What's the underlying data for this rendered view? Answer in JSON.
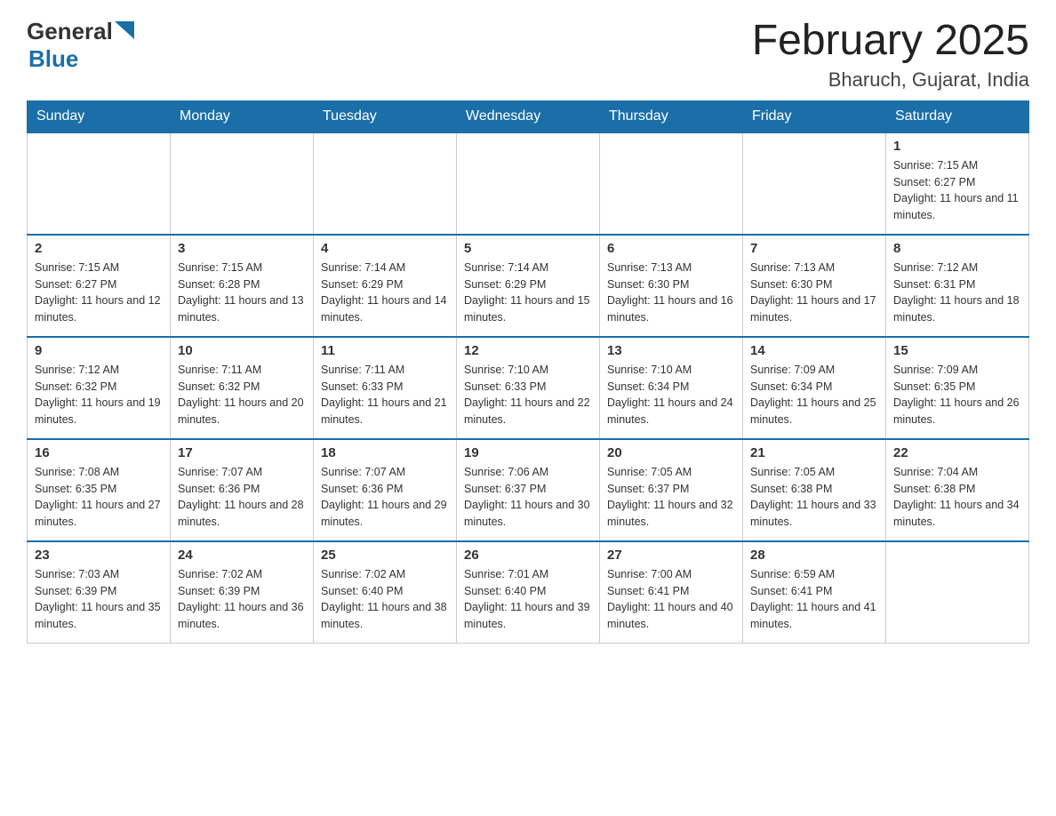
{
  "header": {
    "logo_general": "General",
    "logo_blue": "Blue",
    "month_year": "February 2025",
    "location": "Bharuch, Gujarat, India"
  },
  "days_of_week": [
    "Sunday",
    "Monday",
    "Tuesday",
    "Wednesday",
    "Thursday",
    "Friday",
    "Saturday"
  ],
  "weeks": [
    [
      {
        "day": "",
        "info": ""
      },
      {
        "day": "",
        "info": ""
      },
      {
        "day": "",
        "info": ""
      },
      {
        "day": "",
        "info": ""
      },
      {
        "day": "",
        "info": ""
      },
      {
        "day": "",
        "info": ""
      },
      {
        "day": "1",
        "info": "Sunrise: 7:15 AM\nSunset: 6:27 PM\nDaylight: 11 hours and 11 minutes."
      }
    ],
    [
      {
        "day": "2",
        "info": "Sunrise: 7:15 AM\nSunset: 6:27 PM\nDaylight: 11 hours and 12 minutes."
      },
      {
        "day": "3",
        "info": "Sunrise: 7:15 AM\nSunset: 6:28 PM\nDaylight: 11 hours and 13 minutes."
      },
      {
        "day": "4",
        "info": "Sunrise: 7:14 AM\nSunset: 6:29 PM\nDaylight: 11 hours and 14 minutes."
      },
      {
        "day": "5",
        "info": "Sunrise: 7:14 AM\nSunset: 6:29 PM\nDaylight: 11 hours and 15 minutes."
      },
      {
        "day": "6",
        "info": "Sunrise: 7:13 AM\nSunset: 6:30 PM\nDaylight: 11 hours and 16 minutes."
      },
      {
        "day": "7",
        "info": "Sunrise: 7:13 AM\nSunset: 6:30 PM\nDaylight: 11 hours and 17 minutes."
      },
      {
        "day": "8",
        "info": "Sunrise: 7:12 AM\nSunset: 6:31 PM\nDaylight: 11 hours and 18 minutes."
      }
    ],
    [
      {
        "day": "9",
        "info": "Sunrise: 7:12 AM\nSunset: 6:32 PM\nDaylight: 11 hours and 19 minutes."
      },
      {
        "day": "10",
        "info": "Sunrise: 7:11 AM\nSunset: 6:32 PM\nDaylight: 11 hours and 20 minutes."
      },
      {
        "day": "11",
        "info": "Sunrise: 7:11 AM\nSunset: 6:33 PM\nDaylight: 11 hours and 21 minutes."
      },
      {
        "day": "12",
        "info": "Sunrise: 7:10 AM\nSunset: 6:33 PM\nDaylight: 11 hours and 22 minutes."
      },
      {
        "day": "13",
        "info": "Sunrise: 7:10 AM\nSunset: 6:34 PM\nDaylight: 11 hours and 24 minutes."
      },
      {
        "day": "14",
        "info": "Sunrise: 7:09 AM\nSunset: 6:34 PM\nDaylight: 11 hours and 25 minutes."
      },
      {
        "day": "15",
        "info": "Sunrise: 7:09 AM\nSunset: 6:35 PM\nDaylight: 11 hours and 26 minutes."
      }
    ],
    [
      {
        "day": "16",
        "info": "Sunrise: 7:08 AM\nSunset: 6:35 PM\nDaylight: 11 hours and 27 minutes."
      },
      {
        "day": "17",
        "info": "Sunrise: 7:07 AM\nSunset: 6:36 PM\nDaylight: 11 hours and 28 minutes."
      },
      {
        "day": "18",
        "info": "Sunrise: 7:07 AM\nSunset: 6:36 PM\nDaylight: 11 hours and 29 minutes."
      },
      {
        "day": "19",
        "info": "Sunrise: 7:06 AM\nSunset: 6:37 PM\nDaylight: 11 hours and 30 minutes."
      },
      {
        "day": "20",
        "info": "Sunrise: 7:05 AM\nSunset: 6:37 PM\nDaylight: 11 hours and 32 minutes."
      },
      {
        "day": "21",
        "info": "Sunrise: 7:05 AM\nSunset: 6:38 PM\nDaylight: 11 hours and 33 minutes."
      },
      {
        "day": "22",
        "info": "Sunrise: 7:04 AM\nSunset: 6:38 PM\nDaylight: 11 hours and 34 minutes."
      }
    ],
    [
      {
        "day": "23",
        "info": "Sunrise: 7:03 AM\nSunset: 6:39 PM\nDaylight: 11 hours and 35 minutes."
      },
      {
        "day": "24",
        "info": "Sunrise: 7:02 AM\nSunset: 6:39 PM\nDaylight: 11 hours and 36 minutes."
      },
      {
        "day": "25",
        "info": "Sunrise: 7:02 AM\nSunset: 6:40 PM\nDaylight: 11 hours and 38 minutes."
      },
      {
        "day": "26",
        "info": "Sunrise: 7:01 AM\nSunset: 6:40 PM\nDaylight: 11 hours and 39 minutes."
      },
      {
        "day": "27",
        "info": "Sunrise: 7:00 AM\nSunset: 6:41 PM\nDaylight: 11 hours and 40 minutes."
      },
      {
        "day": "28",
        "info": "Sunrise: 6:59 AM\nSunset: 6:41 PM\nDaylight: 11 hours and 41 minutes."
      },
      {
        "day": "",
        "info": ""
      }
    ]
  ]
}
